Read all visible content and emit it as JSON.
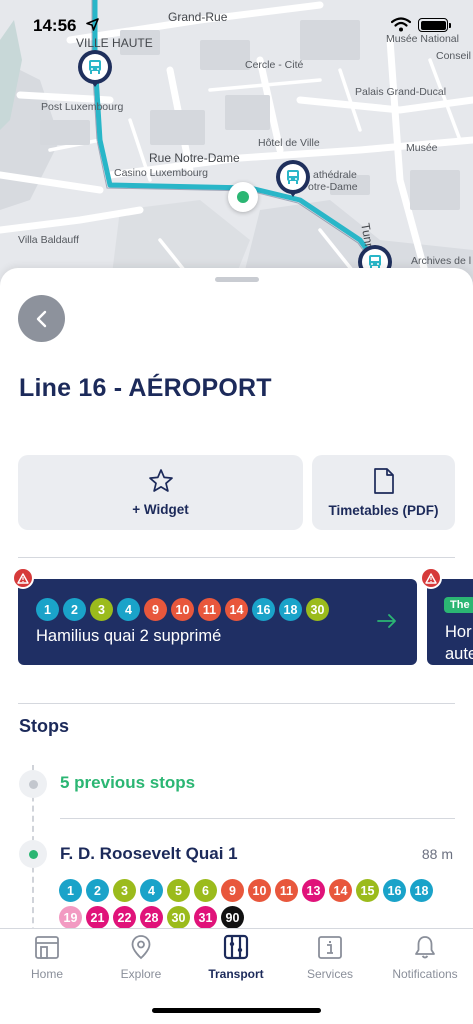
{
  "status_bar": {
    "time": "14:56"
  },
  "map": {
    "labels": {
      "grand_rue": "Grand-Rue",
      "ville_haute": "VILLE HAUTE",
      "musee_national": "Musée National",
      "conseil": "Conseil",
      "post_luxembourg": "Post Luxembourg",
      "cercle_cite": "Cercle - Cité",
      "palais": "Palais Grand-Ducal",
      "hotel_de_ville": "Hôtel de Ville",
      "musee": "Musée",
      "rue_notre_dame": "Rue Notre-Dame",
      "casino": "Casino Luxembourg",
      "cathedrale_1": "athédrale",
      "cathedrale_2": "otre-Dame",
      "tunnel": "Tunnel René",
      "villa_baldauff": "Villa Baldauff",
      "archives": "Archives de l"
    },
    "route_color": "#29b6c8"
  },
  "sheet": {
    "title": "Line 16 - AÉROPORT",
    "actions": {
      "widget_label": "+ Widget",
      "timetables_label": "Timetables (PDF)"
    },
    "alerts": [
      {
        "lines": [
          {
            "n": "1",
            "color": "#1aa3c9"
          },
          {
            "n": "2",
            "color": "#1aa3c9"
          },
          {
            "n": "3",
            "color": "#9bbb1c"
          },
          {
            "n": "4",
            "color": "#1aa3c9"
          },
          {
            "n": "9",
            "color": "#e8573c"
          },
          {
            "n": "10",
            "color": "#e8573c"
          },
          {
            "n": "11",
            "color": "#e8573c"
          },
          {
            "n": "14",
            "color": "#e8573c"
          },
          {
            "n": "16",
            "color": "#1aa3c9"
          },
          {
            "n": "18",
            "color": "#1aa3c9"
          },
          {
            "n": "30",
            "color": "#9bbb1c"
          }
        ],
        "text": "Hamilius quai 2 supprimé"
      },
      {
        "tag": "The",
        "line1": "Hor",
        "line2": "aute"
      }
    ],
    "stops_heading": "Stops",
    "previous_stops": "5 previous stops",
    "stop": {
      "name": "F. D. Roosevelt Quai 1",
      "distance": "88 m",
      "lines": [
        {
          "n": "1",
          "color": "#1aa3c9"
        },
        {
          "n": "2",
          "color": "#1aa3c9"
        },
        {
          "n": "3",
          "color": "#9bbb1c"
        },
        {
          "n": "4",
          "color": "#1aa3c9"
        },
        {
          "n": "5",
          "color": "#9bbb1c"
        },
        {
          "n": "6",
          "color": "#9bbb1c"
        },
        {
          "n": "9",
          "color": "#e8573c"
        },
        {
          "n": "10",
          "color": "#e8573c"
        },
        {
          "n": "11",
          "color": "#e8573c"
        },
        {
          "n": "13",
          "color": "#e0137a"
        },
        {
          "n": "14",
          "color": "#e8573c"
        },
        {
          "n": "15",
          "color": "#9bbb1c"
        },
        {
          "n": "16",
          "color": "#1aa3c9"
        },
        {
          "n": "18",
          "color": "#1aa3c9"
        },
        {
          "n": "19",
          "color": "#f29ac2"
        },
        {
          "n": "21",
          "color": "#e0137a"
        },
        {
          "n": "22",
          "color": "#e0137a"
        },
        {
          "n": "28",
          "color": "#e0137a"
        },
        {
          "n": "30",
          "color": "#9bbb1c"
        },
        {
          "n": "31",
          "color": "#e0137a"
        },
        {
          "n": "90",
          "color": "#111111"
        }
      ]
    }
  },
  "tabbar": {
    "home": "Home",
    "explore": "Explore",
    "transport": "Transport",
    "services": "Services",
    "notifications": "Notifications"
  },
  "colors": {
    "navy": "#1c2a5a",
    "alert_bg": "#1f2f64",
    "accent_green": "#2bb673",
    "warning_red": "#d63a3a"
  }
}
